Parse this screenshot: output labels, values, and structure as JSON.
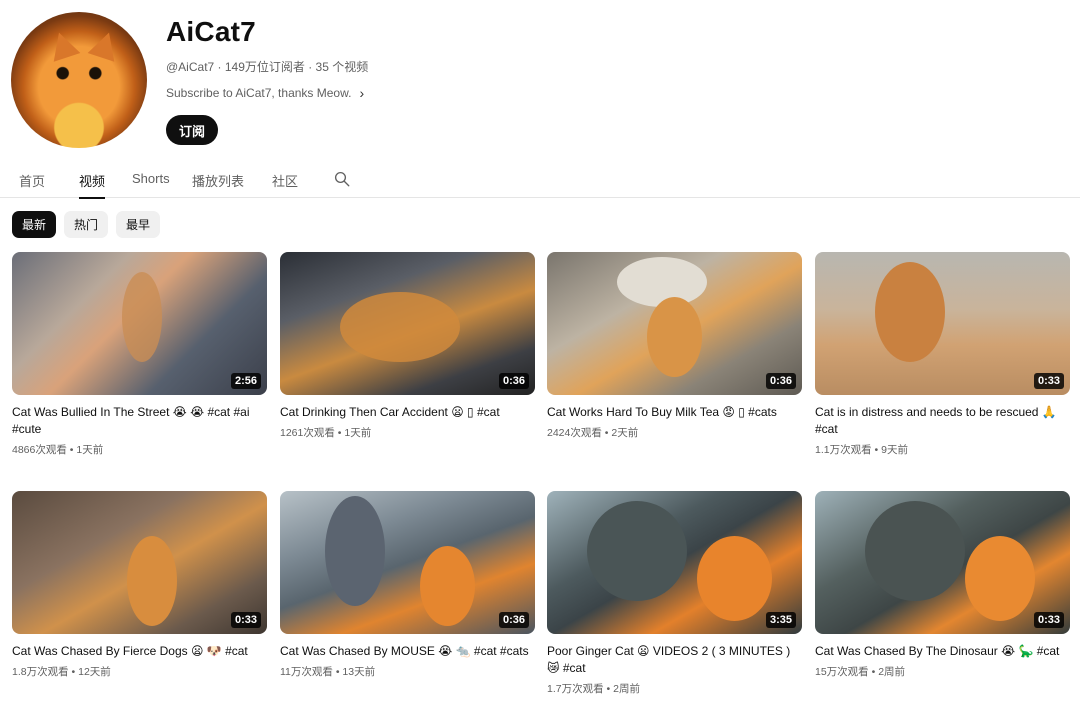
{
  "channel": {
    "name": "AiCat7",
    "meta": "@AiCat7 · 149万位订阅者 · 35 个视频",
    "description": "Subscribe to AiCat7, thanks Meow.",
    "subscribe_label": "订阅"
  },
  "tabs": [
    {
      "label": "首页",
      "active": false
    },
    {
      "label": "视频",
      "active": true
    },
    {
      "label": "Shorts",
      "active": false
    },
    {
      "label": "播放列表",
      "active": false
    },
    {
      "label": "社区",
      "active": false
    }
  ],
  "search_icon": "search-icon",
  "filters": [
    {
      "label": "最新",
      "active": true
    },
    {
      "label": "热门",
      "active": false
    },
    {
      "label": "最早",
      "active": false
    }
  ],
  "videos": [
    {
      "title": "Cat Was Bullied In The Street 😭 😭 #cat #ai #cute",
      "duration": "2:56",
      "views": "4866次观看",
      "age": "1天前"
    },
    {
      "title": "Cat Drinking Then Car Accident 😦 ▯ #cat",
      "duration": "0:36",
      "views": "1261次观看",
      "age": "1天前"
    },
    {
      "title": "Cat Works Hard To Buy Milk Tea 😡 ▯ #cats",
      "duration": "0:36",
      "views": "2424次观看",
      "age": "2天前"
    },
    {
      "title": "Cat is in distress and needs to be rescued 🙏 #cat",
      "duration": "0:33",
      "views": "1.1万次观看",
      "age": "9天前"
    },
    {
      "title": "Cat Was Chased By Fierce Dogs 😦 🐶 #cat",
      "duration": "0:33",
      "views": "1.8万次观看",
      "age": "12天前"
    },
    {
      "title": "Cat Was Chased By MOUSE 😭 🐀 #cat #cats",
      "duration": "0:36",
      "views": "11万次观看",
      "age": "13天前"
    },
    {
      "title": "Poor Ginger Cat 😦 VIDEOS 2 ( 3 MINUTES ) 😿 #cat",
      "duration": "3:35",
      "views": "1.7万次观看",
      "age": "2周前"
    },
    {
      "title": "Cat Was Chased By The Dinosaur 😭 🦕 #cat",
      "duration": "0:33",
      "views": "15万次观看",
      "age": "2周前"
    }
  ],
  "separator": " • ",
  "colors": {
    "accent": "#0f0f0f",
    "chip_bg": "#f0f0f0",
    "muted_text": "#606060"
  }
}
